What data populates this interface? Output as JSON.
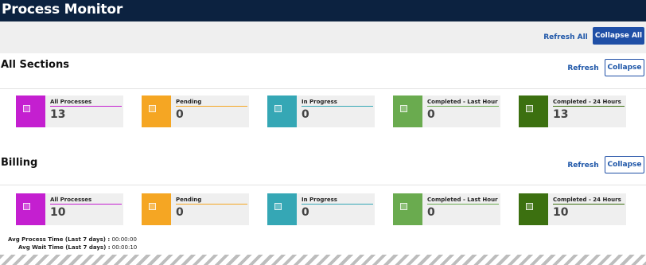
{
  "app": {
    "title": "Process Monitor"
  },
  "toolbar": {
    "refresh_all": "Refresh All",
    "collapse_all": "Collapse All"
  },
  "sections": [
    {
      "title": "All Sections",
      "refresh": "Refresh",
      "collapse": "Collapse",
      "tiles": [
        {
          "label": "All Processes",
          "value": "13",
          "color": "#c41fd0"
        },
        {
          "label": "Pending",
          "value": "0",
          "color": "#f5a623"
        },
        {
          "label": "In Progress",
          "value": "0",
          "color": "#35a7b5"
        },
        {
          "label": "Completed - Last Hour",
          "value": "0",
          "color": "#6aab4f"
        },
        {
          "label": "Completed - 24 Hours",
          "value": "13",
          "color": "#3c7010"
        }
      ]
    },
    {
      "title": "Billing",
      "refresh": "Refresh",
      "collapse": "Collapse",
      "tiles": [
        {
          "label": "All Processes",
          "value": "10",
          "color": "#c41fd0"
        },
        {
          "label": "Pending",
          "value": "0",
          "color": "#f5a623"
        },
        {
          "label": "In Progress",
          "value": "0",
          "color": "#35a7b5"
        },
        {
          "label": "Completed - Last Hour",
          "value": "0",
          "color": "#6aab4f"
        },
        {
          "label": "Completed - 24 Hours",
          "value": "10",
          "color": "#3c7010"
        }
      ],
      "stats": {
        "avg_process_label": "Avg Process Time (Last 7 days) :",
        "avg_process_value": "00:00:00",
        "avg_wait_label": "Avg Wait Time (Last 7 days) :",
        "avg_wait_value": "00:00:10"
      }
    }
  ]
}
